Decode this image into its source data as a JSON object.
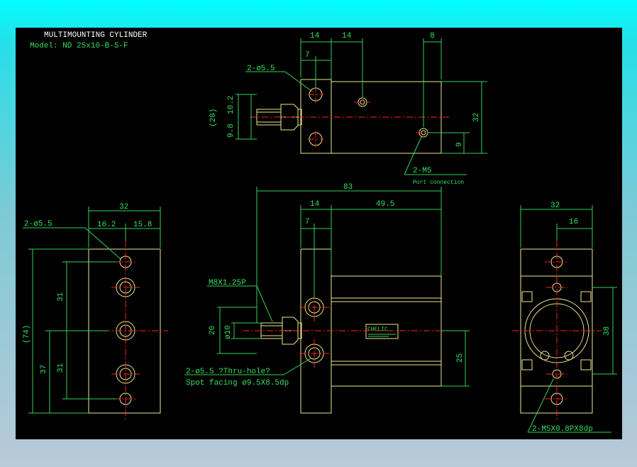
{
  "title": "MULTIMOUNTING CYLINDER",
  "model": "Model: ND 25x10-B-S-F",
  "top_view": {
    "dims": [
      "14",
      "14",
      "8",
      "7",
      "32",
      "9",
      "(20)",
      "9.8",
      "10.2"
    ],
    "callouts": [
      "2-ø5.5",
      "2-M5",
      "Port connection"
    ]
  },
  "side_view": {
    "dims": [
      "83",
      "14",
      "49.5",
      "7",
      "20",
      "ø10",
      "25"
    ],
    "callouts": [
      "M8X1.25P",
      "2-ø5.5 ?Thru-hole?",
      "Spot facing  ø9.5X8.5dp"
    ]
  },
  "left_view": {
    "dims": [
      "32",
      "16.2",
      "15.8",
      "(74)",
      "31",
      "31",
      "37"
    ],
    "callouts": [
      "2-ø5.5"
    ]
  },
  "right_view": {
    "dims": [
      "32",
      "16",
      "38"
    ],
    "callouts": [
      "2-M5X0.8PX8dp"
    ]
  },
  "label_logo": "CHELIC",
  "colors": {
    "background": "#000000",
    "outline": "#f0e68c",
    "dimension": "#34d058",
    "centerline": "#ff2020",
    "title_text": "#ffffff"
  }
}
